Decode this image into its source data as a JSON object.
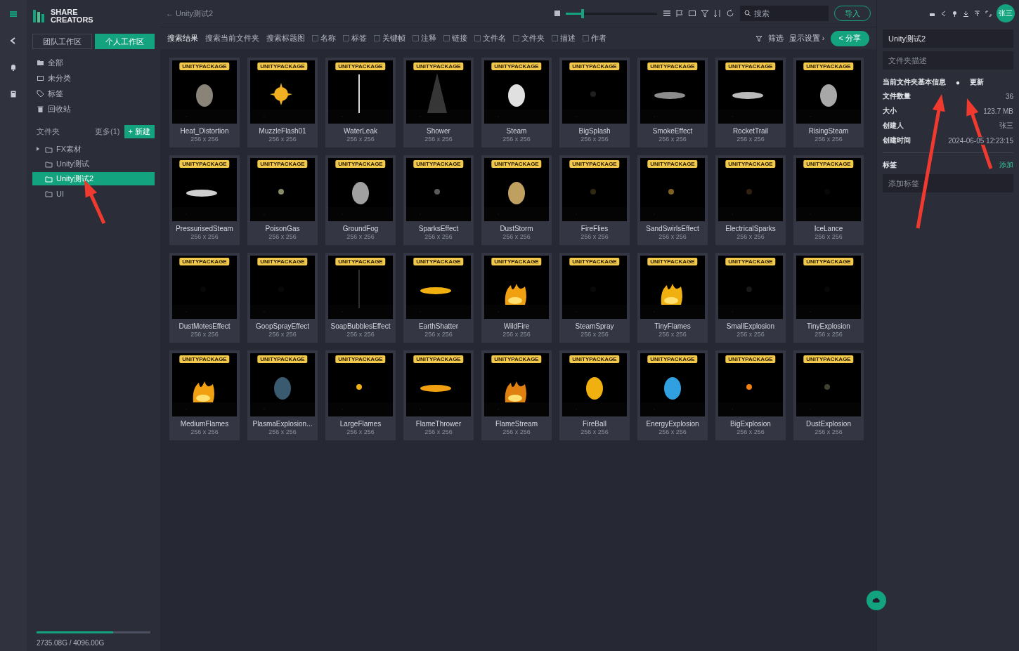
{
  "logo": {
    "line1": "SHARE",
    "line2": "CREATORS"
  },
  "workspace_tabs": [
    {
      "label": "团队工作区",
      "selected": false
    },
    {
      "label": "个人工作区",
      "selected": true
    }
  ],
  "nav_items": [
    {
      "label": "全部"
    },
    {
      "label": "未分类"
    },
    {
      "label": "标签"
    },
    {
      "label": "回收站"
    }
  ],
  "folders_header": {
    "title": "文件夹",
    "more": "更多(1)",
    "new_button": "+ 新建"
  },
  "folders": [
    {
      "label": "FX素材",
      "selected": false,
      "has_children": true
    },
    {
      "label": "Unity测试",
      "selected": false,
      "has_children": false
    },
    {
      "label": "Unity测试2",
      "selected": true,
      "has_children": false
    },
    {
      "label": "UI",
      "selected": false,
      "has_children": false
    }
  ],
  "storage": {
    "level": 0.67,
    "text": "2735.08G / 4096.00G"
  },
  "breadcrumb": "← Unity测试2",
  "zoom_slider": {
    "level": 0.2
  },
  "search": {
    "placeholder": "搜索"
  },
  "import_button": "导入",
  "avatar": "张三",
  "filter_bar": {
    "scopes": [
      {
        "label": "搜索结果",
        "selected": true
      },
      {
        "label": "搜索当前文件夹",
        "selected": false
      },
      {
        "label": "搜索标题图",
        "selected": false
      }
    ],
    "fields": [
      {
        "label": "名称",
        "checked": false
      },
      {
        "label": "标签",
        "checked": false
      },
      {
        "label": "关键帧",
        "checked": false
      },
      {
        "label": "注释",
        "checked": false
      },
      {
        "label": "链接",
        "checked": false
      },
      {
        "label": "文件名",
        "checked": false
      },
      {
        "label": "文件夹",
        "checked": false
      },
      {
        "label": "描述",
        "checked": false
      },
      {
        "label": "作者",
        "checked": false
      }
    ],
    "filter": "筛选",
    "display": "显示设置 ›",
    "share_button": "< 分享"
  },
  "assets": [
    {
      "badge": "UNITYPACKAGE",
      "name": "Heat_Distortion",
      "size": "256 x 256"
    },
    {
      "badge": "UNITYPACKAGE",
      "name": "MuzzleFlash01",
      "size": "256 x 256"
    },
    {
      "badge": "UNITYPACKAGE",
      "name": "WaterLeak",
      "size": "256 x 256"
    },
    {
      "badge": "UNITYPACKAGE",
      "name": "Shower",
      "size": "256 x 256"
    },
    {
      "badge": "UNITYPACKAGE",
      "name": "Steam",
      "size": "256 x 256"
    },
    {
      "badge": "UNITYPACKAGE",
      "name": "BigSplash",
      "size": "256 x 256"
    },
    {
      "badge": "UNITYPACKAGE",
      "name": "SmokeEffect",
      "size": "256 x 256"
    },
    {
      "badge": "UNITYPACKAGE",
      "name": "RocketTrail",
      "size": "256 x 256"
    },
    {
      "badge": "UNITYPACKAGE",
      "name": "RisingSteam",
      "size": "256 x 256"
    },
    {
      "badge": "UNITYPACKAGE",
      "name": "PressurisedSteam",
      "size": "256 x 256"
    },
    {
      "badge": "UNITYPACKAGE",
      "name": "PoisonGas",
      "size": "256 x 256"
    },
    {
      "badge": "UNITYPACKAGE",
      "name": "GroundFog",
      "size": "256 x 256"
    },
    {
      "badge": "UNITYPACKAGE",
      "name": "SparksEffect",
      "size": "256 x 256"
    },
    {
      "badge": "UNITYPACKAGE",
      "name": "DustStorm",
      "size": "256 x 256"
    },
    {
      "badge": "UNITYPACKAGE",
      "name": "FireFlies",
      "size": "256 x 256"
    },
    {
      "badge": "UNITYPACKAGE",
      "name": "SandSwirlsEffect",
      "size": "256 x 256"
    },
    {
      "badge": "UNITYPACKAGE",
      "name": "ElectricalSparks",
      "size": "256 x 256"
    },
    {
      "badge": "UNITYPACKAGE",
      "name": "IceLance",
      "size": "256 x 256"
    },
    {
      "badge": "UNITYPACKAGE",
      "name": "DustMotesEffect",
      "size": "256 x 256"
    },
    {
      "badge": "UNITYPACKAGE",
      "name": "GoopSprayEffect",
      "size": "256 x 256"
    },
    {
      "badge": "UNITYPACKAGE",
      "name": "SoapBubblesEffect",
      "size": "256 x 256"
    },
    {
      "badge": "UNITYPACKAGE",
      "name": "EarthShatter",
      "size": "256 x 256"
    },
    {
      "badge": "UNITYPACKAGE",
      "name": "WildFire",
      "size": "256 x 256"
    },
    {
      "badge": "UNITYPACKAGE",
      "name": "SteamSpray",
      "size": "256 x 256"
    },
    {
      "badge": "UNITYPACKAGE",
      "name": "TinyFlames",
      "size": "256 x 256"
    },
    {
      "badge": "UNITYPACKAGE",
      "name": "SmallExplosion",
      "size": "256 x 256"
    },
    {
      "badge": "UNITYPACKAGE",
      "name": "TinyExplosion",
      "size": "256 x 256"
    },
    {
      "badge": "UNITYPACKAGE",
      "name": "MediumFlames",
      "size": "256 x 256"
    },
    {
      "badge": "UNITYPACKAGE",
      "name": "PlasmaExplosion...",
      "size": "256 x 256"
    },
    {
      "badge": "UNITYPACKAGE",
      "name": "LargeFlames",
      "size": "256 x 256"
    },
    {
      "badge": "UNITYPACKAGE",
      "name": "FlameThrower",
      "size": "256 x 256"
    },
    {
      "badge": "UNITYPACKAGE",
      "name": "FlameStream",
      "size": "256 x 256"
    },
    {
      "badge": "UNITYPACKAGE",
      "name": "FireBall",
      "size": "256 x 256"
    },
    {
      "badge": "UNITYPACKAGE",
      "name": "EnergyExplosion",
      "size": "256 x 256"
    },
    {
      "badge": "UNITYPACKAGE",
      "name": "BigExplosion",
      "size": "256 x 256"
    },
    {
      "badge": "UNITYPACKAGE",
      "name": "DustExplosion",
      "size": "256 x 256"
    }
  ],
  "details": {
    "title": "Unity测试2",
    "description_placeholder": "文件夹描述",
    "section": "当前文件夹基本信息",
    "section_marker": "●",
    "update": "更新",
    "rows": [
      {
        "label": "文件数量",
        "value": "36"
      },
      {
        "label": "大小",
        "value": "123.7 MB"
      },
      {
        "label": "创建人",
        "value": "张三"
      },
      {
        "label": "创建时间",
        "value": "2024-06-05 12:23:15"
      }
    ],
    "tags_label": "标签",
    "add_tag": "添加",
    "tag_placeholder": "添加标签"
  }
}
